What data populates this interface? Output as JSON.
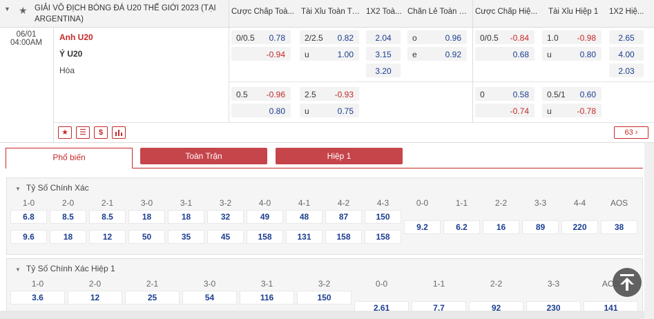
{
  "header": {
    "league": "GIẢI VÔ ĐỊCH BÓNG ĐÁ U20 THẾ GIỚI 2023 (TẠI ARGENTINA)",
    "columns": [
      "Cược Chấp Toà...",
      "Tài Xỉu Toàn Trận",
      "1X2 Toà...",
      "Chẵn Lẻ Toàn Tr...",
      "Cược Chấp Hiệ...",
      "Tài Xỉu Hiệp 1",
      "1X2 Hiệ..."
    ]
  },
  "match": {
    "date": "06/01",
    "time": "04:00AM",
    "home": "Anh U20",
    "away": "Ý U20",
    "draw": "Hòa",
    "line1": {
      "hdp_ft": {
        "label": "0/0.5",
        "home": "0.78",
        "away": "-0.94"
      },
      "ou_ft": {
        "label": "2/2.5",
        "over": "0.82",
        "under_label": "u",
        "under": "1.00"
      },
      "x12_ft": [
        "2.04",
        "3.15",
        "3.20"
      ],
      "oe_ft": {
        "o_label": "o",
        "o": "0.96",
        "e_label": "e",
        "e": "0.92"
      },
      "hdp_h1": {
        "label": "0/0.5",
        "home": "-0.84",
        "away": "0.68"
      },
      "ou_h1": {
        "label": "1.0",
        "over": "-0.98",
        "under_label": "u",
        "under": "0.80"
      },
      "x12_h1": [
        "2.65",
        "4.00",
        "2.03"
      ]
    },
    "line2": {
      "hdp_ft": {
        "label": "0.5",
        "home": "-0.96",
        "away": "0.80"
      },
      "ou_ft": {
        "label": "2.5",
        "over": "-0.93",
        "under_label": "u",
        "under": "0.75"
      },
      "hdp_h1": {
        "label": "0",
        "home": "0.58",
        "away": "-0.74"
      },
      "ou_h1": {
        "label": "0.5/1",
        "over": "0.60",
        "under_label": "u",
        "under": "-0.78"
      }
    },
    "more_count": "63"
  },
  "icons": {
    "star": "star-icon",
    "list": "list-icon",
    "dollar": "dollar-icon",
    "stats": "bar-chart-icon"
  },
  "tabs": [
    "Phổ biến",
    "Toàn Trận",
    "Hiệp 1"
  ],
  "correct_score": {
    "title": "Tỷ Số Chính Xác",
    "scores": [
      "1-0",
      "2-0",
      "2-1",
      "3-0",
      "3-1",
      "3-2",
      "4-0",
      "4-1",
      "4-2",
      "4-3",
      "0-0",
      "1-1",
      "2-2",
      "3-3",
      "4-4",
      "AOS"
    ],
    "home_odds": [
      "6.8",
      "8.5",
      "8.5",
      "18",
      "18",
      "32",
      "49",
      "48",
      "87",
      "150"
    ],
    "away_odds": [
      "9.6",
      "18",
      "12",
      "50",
      "35",
      "45",
      "158",
      "131",
      "158",
      "158"
    ],
    "draw_odds": [
      "9.2",
      "6.2",
      "16",
      "89",
      "220",
      "38"
    ]
  },
  "correct_score_h1": {
    "title": "Tỷ Số Chính Xác Hiệp 1",
    "scores": [
      "1-0",
      "2-0",
      "2-1",
      "3-0",
      "3-1",
      "3-2",
      "0-0",
      "1-1",
      "2-2",
      "3-3",
      "AOS"
    ],
    "home_odds": [
      "3.6",
      "12",
      "25",
      "54",
      "116",
      "150"
    ],
    "draw_odds": [
      "2.61",
      "7.7",
      "92",
      "230",
      "141"
    ]
  },
  "colors": {
    "accent": "#c62828",
    "odds_blue": "#1a3d8f",
    "tab_fill": "#c6454a"
  }
}
